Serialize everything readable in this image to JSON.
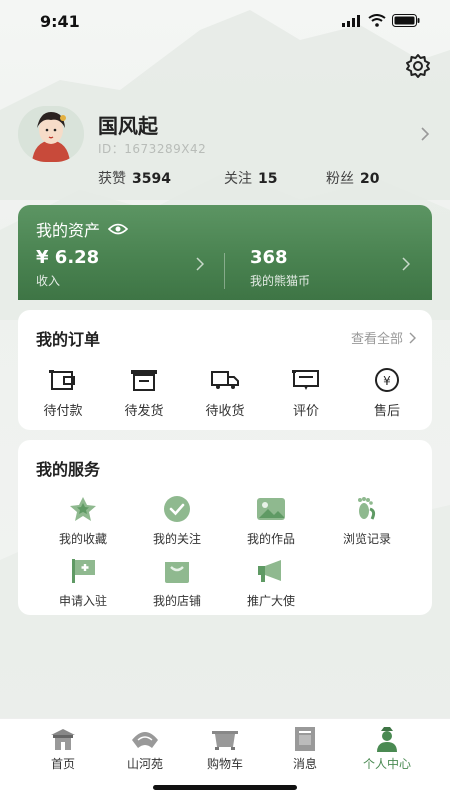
{
  "status_bar": {
    "time": "9:41"
  },
  "profile": {
    "name": "国风起",
    "id_text": "ID：1673289X42",
    "stats": [
      {
        "label": "获赞",
        "value": "3594"
      },
      {
        "label": "关注",
        "value": "15"
      },
      {
        "label": "粉丝",
        "value": "20"
      }
    ]
  },
  "assets": {
    "title": "我的资产",
    "income_value": "¥ 6.28",
    "income_label": "收入",
    "coins_value": "368",
    "coins_label": "我的熊猫币"
  },
  "orders": {
    "title": "我的订单",
    "view_all": "查看全部",
    "items": [
      {
        "label": "待付款",
        "icon": "wallet-icon"
      },
      {
        "label": "待发货",
        "icon": "package-icon"
      },
      {
        "label": "待收货",
        "icon": "truck-icon"
      },
      {
        "label": "评价",
        "icon": "comment-icon"
      },
      {
        "label": "售后",
        "icon": "yen-icon"
      }
    ]
  },
  "services": {
    "title": "我的服务",
    "items": [
      {
        "label": "我的收藏",
        "icon": "star-icon"
      },
      {
        "label": "我的关注",
        "icon": "check-icon"
      },
      {
        "label": "我的作品",
        "icon": "image-icon"
      },
      {
        "label": "浏览记录",
        "icon": "footprint-icon"
      },
      {
        "label": "申请入驻",
        "icon": "flag-icon"
      },
      {
        "label": "我的店铺",
        "icon": "shop-icon"
      },
      {
        "label": "推广大使",
        "icon": "megaphone-icon"
      }
    ]
  },
  "tabbar": {
    "items": [
      {
        "label": "首页",
        "icon": "home-icon",
        "active": false
      },
      {
        "label": "山河苑",
        "icon": "fan-icon",
        "active": false
      },
      {
        "label": "购物车",
        "icon": "cart-icon",
        "active": false
      },
      {
        "label": "消息",
        "icon": "message-icon",
        "active": false
      },
      {
        "label": "个人中心",
        "icon": "person-icon",
        "active": true
      }
    ]
  },
  "colors": {
    "accent": "#4a8351",
    "active_tab": "#4a8a52"
  }
}
